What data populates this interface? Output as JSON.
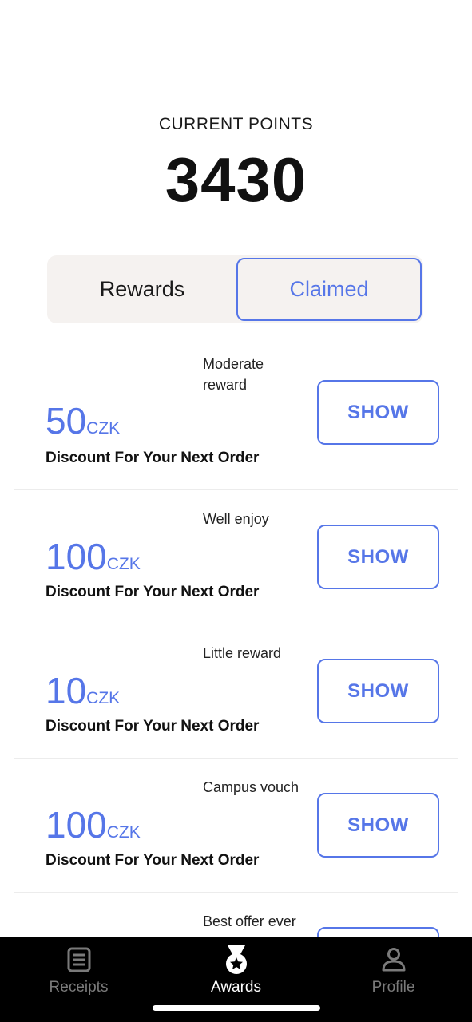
{
  "points": {
    "label": "CURRENT POINTS",
    "value": "3430"
  },
  "segmented": {
    "rewards_label": "Rewards",
    "claimed_label": "Claimed",
    "selected": "Claimed"
  },
  "rewards": [
    {
      "name": "Moderate reward",
      "amount": "50",
      "currency": "CZK",
      "description": "Discount For Your Next Order",
      "button": "SHOW"
    },
    {
      "name": "Well enjoy",
      "amount": "100",
      "currency": "CZK",
      "description": "Discount For Your Next Order",
      "button": "SHOW"
    },
    {
      "name": "Little reward",
      "amount": "10",
      "currency": "CZK",
      "description": "Discount For Your Next Order",
      "button": "SHOW"
    },
    {
      "name": "Campus vouch",
      "amount": "100",
      "currency": "CZK",
      "description": "Discount For Your Next Order",
      "button": "SHOW"
    },
    {
      "name": "Best offer ever",
      "amount": "",
      "currency": "",
      "description": "",
      "button": ""
    }
  ],
  "tabbar": {
    "items": [
      {
        "label": "Receipts",
        "icon": "receipt-icon",
        "active": false
      },
      {
        "label": "Awards",
        "icon": "medal-icon",
        "active": true
      },
      {
        "label": "Profile",
        "icon": "person-icon",
        "active": false
      }
    ]
  },
  "colors": {
    "accent": "#5676e8",
    "segment_bg": "#f5f2f0",
    "tabbar_bg": "#000000",
    "tab_inactive": "#7a7a7a"
  }
}
